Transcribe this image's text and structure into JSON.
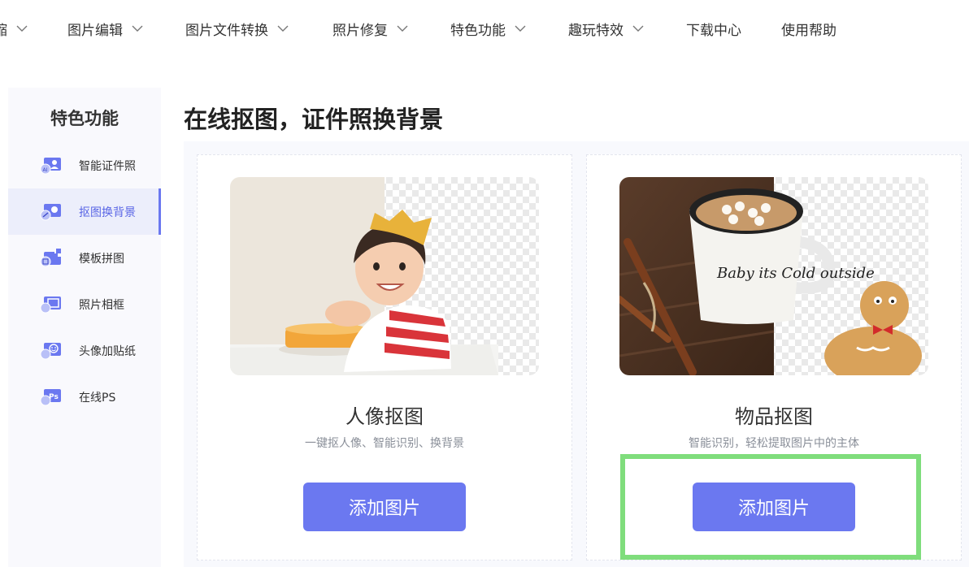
{
  "nav": {
    "items": [
      {
        "label": "缩",
        "has_dropdown": true
      },
      {
        "label": "图片编辑",
        "has_dropdown": true
      },
      {
        "label": "图片文件转换",
        "has_dropdown": true
      },
      {
        "label": "照片修复",
        "has_dropdown": true
      },
      {
        "label": "特色功能",
        "has_dropdown": true
      },
      {
        "label": "趣玩特效",
        "has_dropdown": true
      },
      {
        "label": "下载中心",
        "has_dropdown": false
      },
      {
        "label": "使用帮助",
        "has_dropdown": false
      }
    ]
  },
  "sidebar": {
    "title": "特色功能",
    "items": [
      {
        "label": "智能证件照",
        "icon": "id-photo-icon",
        "active": false
      },
      {
        "label": "抠图换背景",
        "icon": "cutout-icon",
        "active": true
      },
      {
        "label": "模板拼图",
        "icon": "template-collage-icon",
        "active": false
      },
      {
        "label": "照片相框",
        "icon": "photo-frame-icon",
        "active": false
      },
      {
        "label": "头像加贴纸",
        "icon": "avatar-sticker-icon",
        "active": false
      },
      {
        "label": "在线PS",
        "icon": "online-ps-icon",
        "active": false
      }
    ]
  },
  "main": {
    "title": "在线抠图，证件照换背景",
    "cards": [
      {
        "title": "人像抠图",
        "desc": "一键抠人像、智能识别、换背景",
        "button": "添加图片"
      },
      {
        "title": "物品抠图",
        "desc": "智能识别，轻松提取图片中的主体",
        "button": "添加图片",
        "mug_text": "Baby its Cold outside"
      }
    ]
  },
  "colors": {
    "accent": "#6b78f0",
    "highlight": "#7fdd7c",
    "sidebar_bg": "#f9f9fd",
    "active_bg": "#eceefb"
  }
}
